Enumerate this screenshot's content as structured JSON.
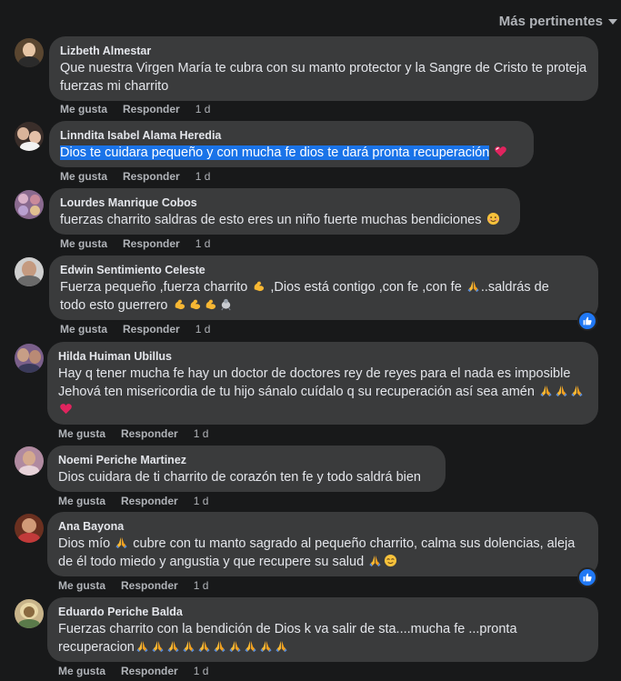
{
  "sort": {
    "label": "Más pertinentes",
    "icon": "chevron-down-icon"
  },
  "actions": {
    "like": "Me gusta",
    "reply": "Responder"
  },
  "comments": [
    {
      "author": "Lizbeth Almestar",
      "text": "Que nuestra Virgen María te cubra con su manto protector y la Sangre de Cristo te proteja fuerzas mi charrito",
      "time": "1 d"
    },
    {
      "author": "Linndita Isabel Alama Heredia",
      "text": "Dios te cuidara pequeño y con mucha fe dios te dará pronta recuperación",
      "time": "1 d"
    },
    {
      "author": "Lourdes Manrique Cobos",
      "text": "fuerzas charrito saldras de esto eres un niño fuerte muchas bendiciones",
      "time": "1 d"
    },
    {
      "author": "Edwin Sentimiento Celeste",
      "text_a": "Fuerza pequeño ,fuerza charrito",
      "text_b": ",Dios está contigo ,con fe ,con fe",
      "text_c": "..saldrás de",
      "text_d": "todo esto guerrero",
      "time": "1 d"
    },
    {
      "author": "Hilda Huiman Ubillus",
      "text": "Hay q tener mucha fe hay un doctor de doctores rey de reyes para el nada es imposible Jehová ten misericordia de tu hijo sánalo cuídalo q su recuperación así sea amén",
      "time": "1 d"
    },
    {
      "author": "Noemi Periche Martinez",
      "text": "Dios cuidara de ti charrito de corazón ten fe y todo saldrá bien",
      "time": "1 d"
    },
    {
      "author": "Ana Bayona",
      "text_a": "Dios mío",
      "text_b": "cubre con tu manto sagrado al pequeño charrito, calma sus dolencias, aleja de él todo miedo y angustia y que recupere su salud",
      "time": "1 d"
    },
    {
      "author": "Eduardo Periche Balda",
      "text": "Fuerzas charrito con la bendición de Dios k va salir de sta....mucha fe ...pronta recuperacion",
      "time": "1 d"
    }
  ],
  "colors": {
    "background": "#18191a",
    "bubble": "#3a3b3c",
    "highlight": "#1a73e8",
    "like_badge": "#2078f4"
  }
}
